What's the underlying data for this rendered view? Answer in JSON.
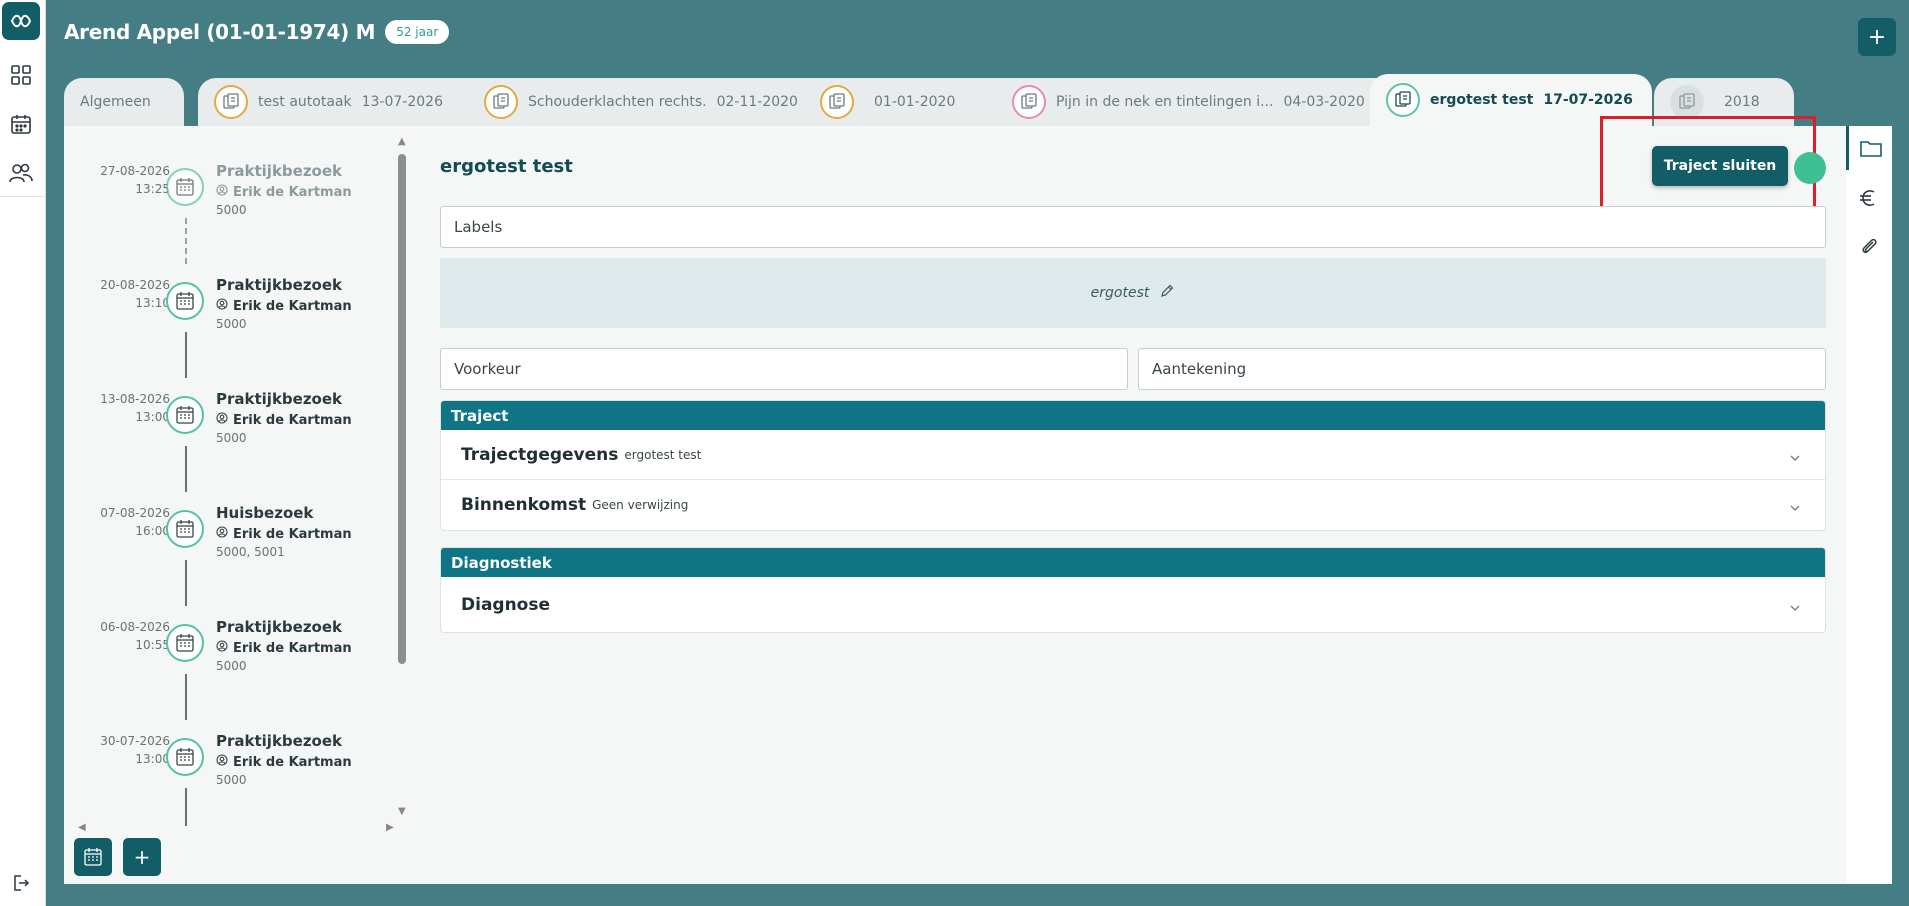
{
  "patient": {
    "name": "Arend Appel (01-01-1974) M",
    "age": "52 jaar"
  },
  "header": {
    "add_label": "+"
  },
  "tabs": [
    {
      "label": "Algemeen",
      "date": ""
    },
    {
      "label": "test autotaak",
      "date": "13-07-2026"
    },
    {
      "label": "Schouderklachten rechts.",
      "date": "02-11-2020"
    },
    {
      "label": "",
      "date": "01-01-2020"
    },
    {
      "label": "Pijn in de nek en tintelingen i...",
      "date": "04-03-2020"
    },
    {
      "label": "ergotest test",
      "date": "17-07-2026"
    },
    {
      "label": "",
      "date": "2018"
    }
  ],
  "timeline": [
    {
      "date": "27-08-2026",
      "time": "13:25",
      "type": "Praktijkbezoek",
      "therapist": "Erik de Kartman",
      "code": "5000"
    },
    {
      "date": "20-08-2026",
      "time": "13:10",
      "type": "Praktijkbezoek",
      "therapist": "Erik de Kartman",
      "code": "5000"
    },
    {
      "date": "13-08-2026",
      "time": "13:00",
      "type": "Praktijkbezoek",
      "therapist": "Erik de Kartman",
      "code": "5000"
    },
    {
      "date": "07-08-2026",
      "time": "16:00",
      "type": "Huisbezoek",
      "therapist": "Erik de Kartman",
      "code": "5000, 5001"
    },
    {
      "date": "06-08-2026",
      "time": "10:55",
      "type": "Praktijkbezoek",
      "therapist": "Erik de Kartman",
      "code": "5000"
    },
    {
      "date": "30-07-2026",
      "time": "13:00",
      "type": "Praktijkbezoek",
      "therapist": "Erik de Kartman",
      "code": "5000"
    }
  ],
  "timeline_actions": {
    "add_label": "+"
  },
  "traject": {
    "title": "ergotest test",
    "close_label": "Traject sluiten",
    "labels_placeholder": "Labels",
    "label_value": "ergotest",
    "voorkeur_placeholder": "Voorkeur",
    "aantekening_placeholder": "Aantekening"
  },
  "sections": {
    "traject": {
      "title": "Traject",
      "rows": [
        {
          "title": "Trajectgegevens",
          "sub": "ergotest test"
        },
        {
          "title": "Binnenkomst",
          "sub": "Geen verwijzing"
        }
      ]
    },
    "diagnostiek": {
      "title": "Diagnostiek",
      "rows": [
        {
          "title": "Diagnose",
          "sub": ""
        }
      ]
    }
  },
  "colors": {
    "primary": "#135e66",
    "background": "#457d84",
    "section_header": "#0f7585",
    "accent_green": "#3fbf94",
    "highlight_red": "#d9202a"
  }
}
